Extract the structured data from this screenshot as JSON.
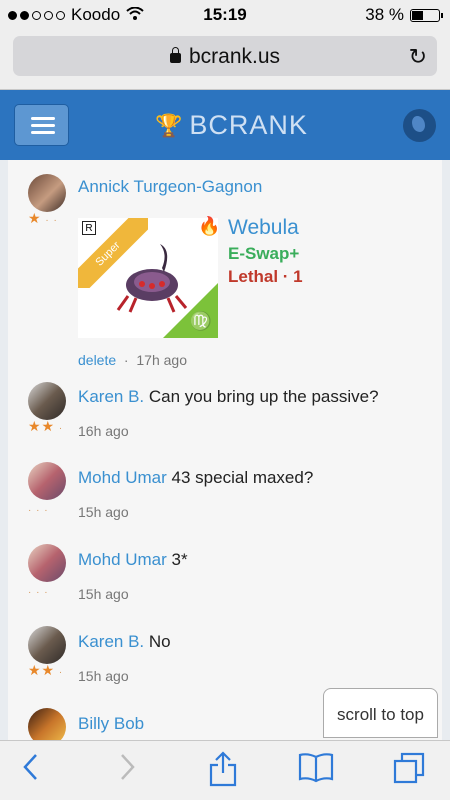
{
  "status": {
    "carrier": "Koodo",
    "time": "15:19",
    "battery": "38 %",
    "battery_level": 0.38
  },
  "browser": {
    "url": "bcrank.us"
  },
  "header": {
    "brand": "BCRANK"
  },
  "comments": [
    {
      "name": "Annick Turgeon-Gagnon",
      "text": "",
      "stars": 1,
      "actions": "delete",
      "time": "17h ago",
      "card": {
        "badge": "Super",
        "monster": "Webula",
        "eswap": "E-Swap+",
        "trait": "Lethal · 1"
      }
    },
    {
      "name": "Karen B.",
      "text": "Can you bring up the passive?",
      "stars": 2,
      "time": "16h ago"
    },
    {
      "name": "Mohd Umar",
      "text": "43 special maxed?",
      "stars": 0,
      "time": "15h ago"
    },
    {
      "name": "Mohd Umar",
      "text": "3*",
      "stars": 0,
      "time": "15h ago"
    },
    {
      "name": "Karen B.",
      "text": "No",
      "stars": 2,
      "time": "15h ago"
    },
    {
      "name": "Billy Bob",
      "text": "",
      "stars": 0,
      "time": ""
    }
  ],
  "scroll_to_top": "scroll to top",
  "icons": {
    "menu": "hamburger-icon",
    "trophy": "trophy-icon",
    "globe": "globe-icon",
    "back": "back-icon",
    "forward": "forward-icon",
    "share": "share-icon",
    "bookmarks": "bookmarks-icon",
    "tabs": "tabs-icon"
  },
  "colors": {
    "header": "#2c74bf",
    "link": "#3a90d0",
    "eswap": "#3aad5b",
    "lethal": "#c0392b",
    "star": "#e8882b"
  }
}
